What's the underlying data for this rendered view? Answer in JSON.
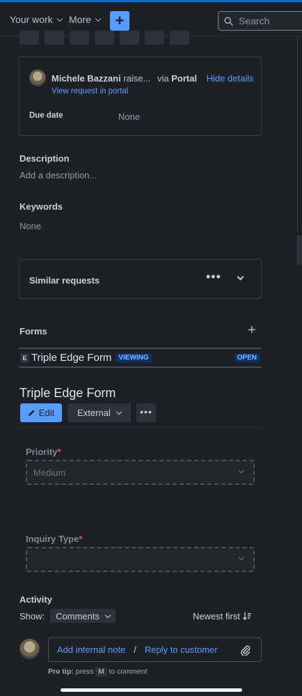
{
  "topbar": {
    "your_work": "Your work",
    "more": "More",
    "create": "+",
    "search_placeholder": "Search"
  },
  "request": {
    "requester": "Michele Bazzani",
    "action": "raise...",
    "via": "via",
    "channel": "Portal",
    "hide_details": "Hide details",
    "view_request": "View request in portal",
    "due_date_label": "Due date",
    "due_date_value": "None"
  },
  "description": {
    "title": "Description",
    "placeholder": "Add a description..."
  },
  "keywords": {
    "title": "Keywords",
    "value": "None"
  },
  "similar": {
    "title": "Similar requests"
  },
  "forms": {
    "title": "Forms",
    "add": "+",
    "badge": "E",
    "form_name": "Triple Edge Form",
    "viewing": "VIEWING",
    "status": "OPEN"
  },
  "form": {
    "title": "Triple Edge Form",
    "edit": "Edit",
    "visibility": "External",
    "priority_label": "Priority",
    "priority_value": "Medium",
    "inquiry_label": "Inquiry Type",
    "inquiry_value": "",
    "required_mark": "*"
  },
  "activity": {
    "title": "Activity",
    "show_label": "Show:",
    "filter": "Comments",
    "sort": "Newest first",
    "add_internal": "Add internal note",
    "separator": "/",
    "reply": "Reply to customer",
    "protip_label": "Pro tip:",
    "protip_press": "press",
    "protip_key": "M",
    "protip_rest": "to comment"
  },
  "colors": {
    "accent": "#579dff",
    "background": "#1d2125",
    "required": "#f15b50"
  }
}
